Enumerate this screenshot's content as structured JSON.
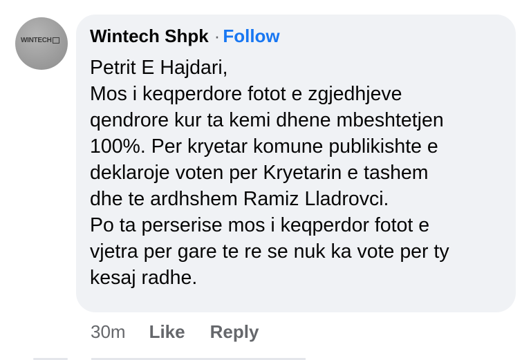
{
  "avatar": {
    "logo_text": "WINTECH",
    "icon": "company-logo"
  },
  "comment": {
    "author": "Wintech Shpk",
    "separator": "·",
    "follow_label": "Follow",
    "lines": [
      "Petrit E Hajdari,",
      "Mos i keqperdore fotot e zgjedhjeve",
      "qendrore kur ta kemi dhene mbeshtetjen",
      "100%. Per kryetar komune publikishte e",
      "deklaroje voten per Kryetarin e tashem",
      "dhe te ardhshem Ramiz Lladrovci.",
      "Po ta perserise mos i keqperdor fotot e",
      "vjetra per gare te re se nuk ka vote per ty",
      "kesaj radhe."
    ]
  },
  "actions": {
    "timestamp": "30m",
    "like_label": "Like",
    "reply_label": "Reply"
  },
  "colors": {
    "bubble_bg": "#f0f2f5",
    "follow": "#1877f2",
    "secondary_text": "#65676b",
    "primary_text": "#050505"
  }
}
